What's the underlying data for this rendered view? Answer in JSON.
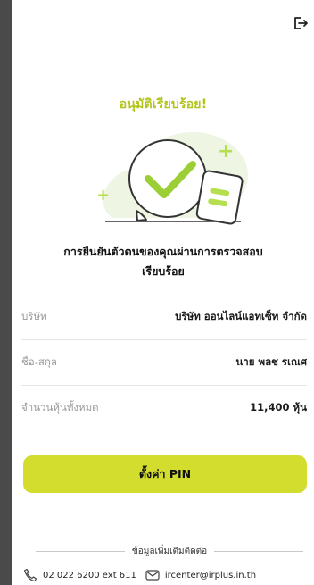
{
  "approval": {
    "title": "อนุมัติเรียบร้อย!",
    "message_line1": "การยืนยันตัวตนของคุณผ่านการตรวจสอบ",
    "message_line2": "เรียบร้อย"
  },
  "info": [
    {
      "label": "บริษัท",
      "value": "บริษัท ออนไลน์แอทเซ็ท จำกัด"
    },
    {
      "label": "ชื่อ-สกุล",
      "value": "นาย พลช รเณศ"
    },
    {
      "label": "จำนวนหุ้นทั้งหมด",
      "value": "11,400 หุ้น"
    }
  ],
  "actions": {
    "set_pin_label": "ตั้งค่า PIN"
  },
  "contact": {
    "heading": "ข้อมูลเพิ่มเติมติดต่อ",
    "phone": "02 022 6200 ext 611",
    "email": "ircenter@irplus.in.th"
  },
  "icons": {
    "logout": "logout-icon",
    "success_illustration": "success-check-document-icon",
    "phone": "phone-icon",
    "email": "mail-icon"
  },
  "colors": {
    "accent": "#d2dd2e",
    "title": "#b3c41e",
    "check": "#9ccf35",
    "plus": "#b6df4f"
  }
}
